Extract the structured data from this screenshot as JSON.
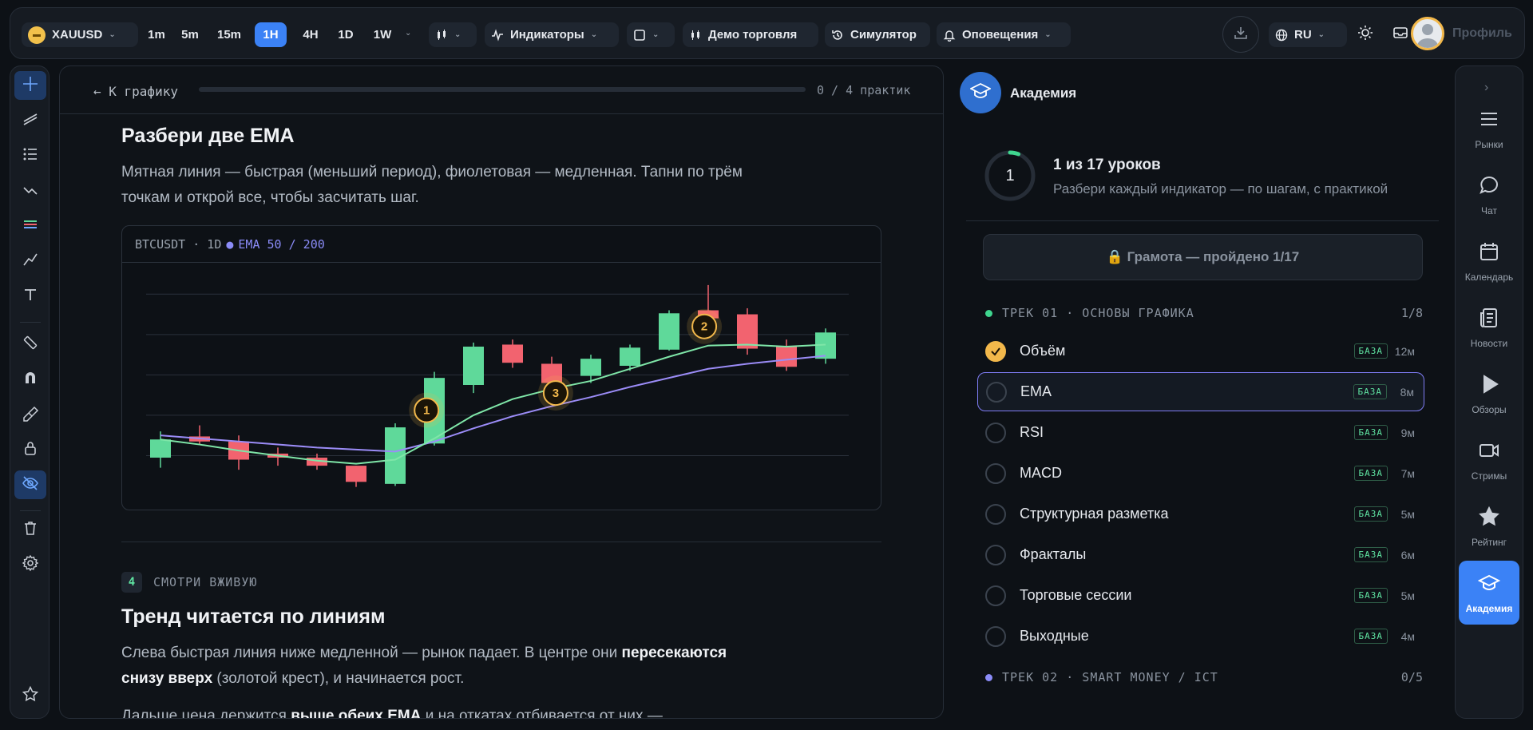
{
  "topbar": {
    "symbol": "XAUUSD",
    "timeframes": [
      "1m",
      "5m",
      "15m",
      "1H",
      "4H",
      "1D",
      "1W"
    ],
    "active_timeframe": "1H",
    "indicators_label": "Индикаторы",
    "demo_label": "Демо торговля",
    "simulator_label": "Симулятор",
    "alerts_label": "Оповещения",
    "language": "RU",
    "profile_label": "Профиль"
  },
  "lesson": {
    "back_label": "← К графику",
    "progress_text": "0 / 4 практик",
    "progress_fraction": 0,
    "section_title": "Разбери две EMA",
    "section_text": "Мятная линия — быстрая (меньший период), фиолетовая — медленная. Тапни по трём точкам и открой все, чтобы засчитать шаг.",
    "chart_symbol": "BTCUSDT · 1D",
    "chart_ema": "EMA 50 / 200",
    "step_number": "4",
    "step_label": "СМОТРИ ВЖИВУЮ",
    "trend_title": "Тренд читается по линиям",
    "trend_p1_a": "Слева быстрая линия ниже медленной — рынок падает. В центре они ",
    "trend_p1_b": "пересекаются снизу вверх",
    "trend_p1_c": " (золотой крест), и начинается рост.",
    "trend_p2_a": "Дальше цена держится ",
    "trend_p2_b": "выше обеих EMA",
    "trend_p2_c": " и на откатах отбивается от них —"
  },
  "chart_data": {
    "type": "candlestick",
    "candles": [
      {
        "o": 3.8,
        "c": 5.6,
        "h": 6.4,
        "l": 2.8
      },
      {
        "o": 5.9,
        "c": 5.4,
        "h": 7.0,
        "l": 5.1
      },
      {
        "o": 5.4,
        "c": 3.6,
        "h": 6.0,
        "l": 2.6
      },
      {
        "o": 4.2,
        "c": 3.8,
        "h": 4.8,
        "l": 3.0
      },
      {
        "o": 3.8,
        "c": 3.0,
        "h": 4.2,
        "l": 2.6
      },
      {
        "o": 3.0,
        "c": 1.4,
        "h": 3.0,
        "l": 0.9
      },
      {
        "o": 1.2,
        "c": 6.8,
        "h": 7.2,
        "l": 1.0
      },
      {
        "o": 5.2,
        "c": 11.7,
        "h": 12.3,
        "l": 5.0
      },
      {
        "o": 11.0,
        "c": 14.8,
        "h": 15.2,
        "l": 10.2
      },
      {
        "o": 15.0,
        "c": 13.2,
        "h": 15.5,
        "l": 12.7
      },
      {
        "o": 13.1,
        "c": 11.2,
        "h": 13.8,
        "l": 10.8
      },
      {
        "o": 11.9,
        "c": 13.6,
        "h": 14.0,
        "l": 11.2
      },
      {
        "o": 12.9,
        "c": 14.7,
        "h": 15.0,
        "l": 12.4
      },
      {
        "o": 14.5,
        "c": 18.1,
        "h": 18.4,
        "l": 14.4
      },
      {
        "o": 18.4,
        "c": 17.6,
        "h": 20.9,
        "l": 17.2
      },
      {
        "o": 18.0,
        "c": 14.6,
        "h": 18.6,
        "l": 14.0
      },
      {
        "o": 14.8,
        "c": 12.8,
        "h": 15.5,
        "l": 12.4
      },
      {
        "o": 13.6,
        "c": 16.2,
        "h": 16.6,
        "l": 13.1
      }
    ],
    "fast_ema": [
      5.6,
      5.1,
      4.5,
      4.0,
      3.5,
      3.2,
      3.6,
      5.7,
      8.0,
      9.6,
      10.6,
      11.4,
      12.6,
      13.8,
      14.9,
      15.0,
      14.8,
      15.0
    ],
    "slow_ema": [
      6.0,
      5.7,
      5.4,
      5.1,
      4.8,
      4.6,
      4.4,
      5.4,
      6.7,
      7.9,
      8.9,
      9.8,
      10.8,
      11.7,
      12.6,
      13.1,
      13.5,
      13.9
    ],
    "ylim": [
      0,
      22
    ],
    "markers": [
      {
        "label": "1",
        "index": 6.8,
        "value": 8.5
      },
      {
        "label": "3",
        "index": 10.1,
        "value": 10.2
      },
      {
        "label": "2",
        "index": 13.9,
        "value": 16.8
      }
    ],
    "colors": {
      "up": "#5fd99a",
      "down": "#f2636f",
      "fast": "#7fe6a8",
      "slow": "#9b8cf7",
      "marker": "#f2b84b",
      "grid": "#2a313b"
    }
  },
  "academy": {
    "title": "Академия",
    "ring_number": "1",
    "progress_fraction": 0.059,
    "lessons_count": "1 из 17 уроков",
    "lessons_sub": "Разбери каждый индикатор — по шагам, с практикой",
    "gramota": "🔒 Грамота — пройдено 1/17",
    "track1_label": "ТРЕК 01 · ОСНОВЫ ГРАФИКА",
    "track1_count": "1/8",
    "track2_label": "ТРЕК 02 · SMART MONEY / ICT",
    "track2_count": "0/5",
    "badge_label": "БАЗА",
    "lessons": [
      {
        "name": "Объём",
        "duration": "12м",
        "done": true
      },
      {
        "name": "EMA",
        "duration": "8м",
        "done": false
      },
      {
        "name": "RSI",
        "duration": "9м",
        "done": false
      },
      {
        "name": "MACD",
        "duration": "7м",
        "done": false
      },
      {
        "name": "Структурная разметка",
        "duration": "5м",
        "done": false
      },
      {
        "name": "Фракталы",
        "duration": "6м",
        "done": false
      },
      {
        "name": "Торговые сессии",
        "duration": "5м",
        "done": false
      },
      {
        "name": "Выходные",
        "duration": "4м",
        "done": false
      }
    ]
  },
  "rightnav": [
    "Рынки",
    "Чат",
    "Календарь",
    "Новости",
    "Обзоры",
    "Стримы",
    "Рейтинг",
    "Академия"
  ],
  "icons": {
    "topbar": [
      "coin-icon",
      "candles-icon",
      "pulse-icon",
      "square-icon",
      "candle-icon",
      "history-icon",
      "bell-icon",
      "download-icon",
      "globe-icon",
      "sun-icon",
      "inbox-icon",
      "avatar"
    ],
    "lefttools": [
      "crosshair-icon",
      "trendline-icon",
      "list-icon",
      "zigzag-icon",
      "ribbons-icon",
      "polyline-icon",
      "text-icon",
      "ruler-icon",
      "magnet-icon",
      "brush-icon",
      "lock-icon",
      "eye-off-icon",
      "trash-icon",
      "settings-icon",
      "star-icon"
    ]
  }
}
